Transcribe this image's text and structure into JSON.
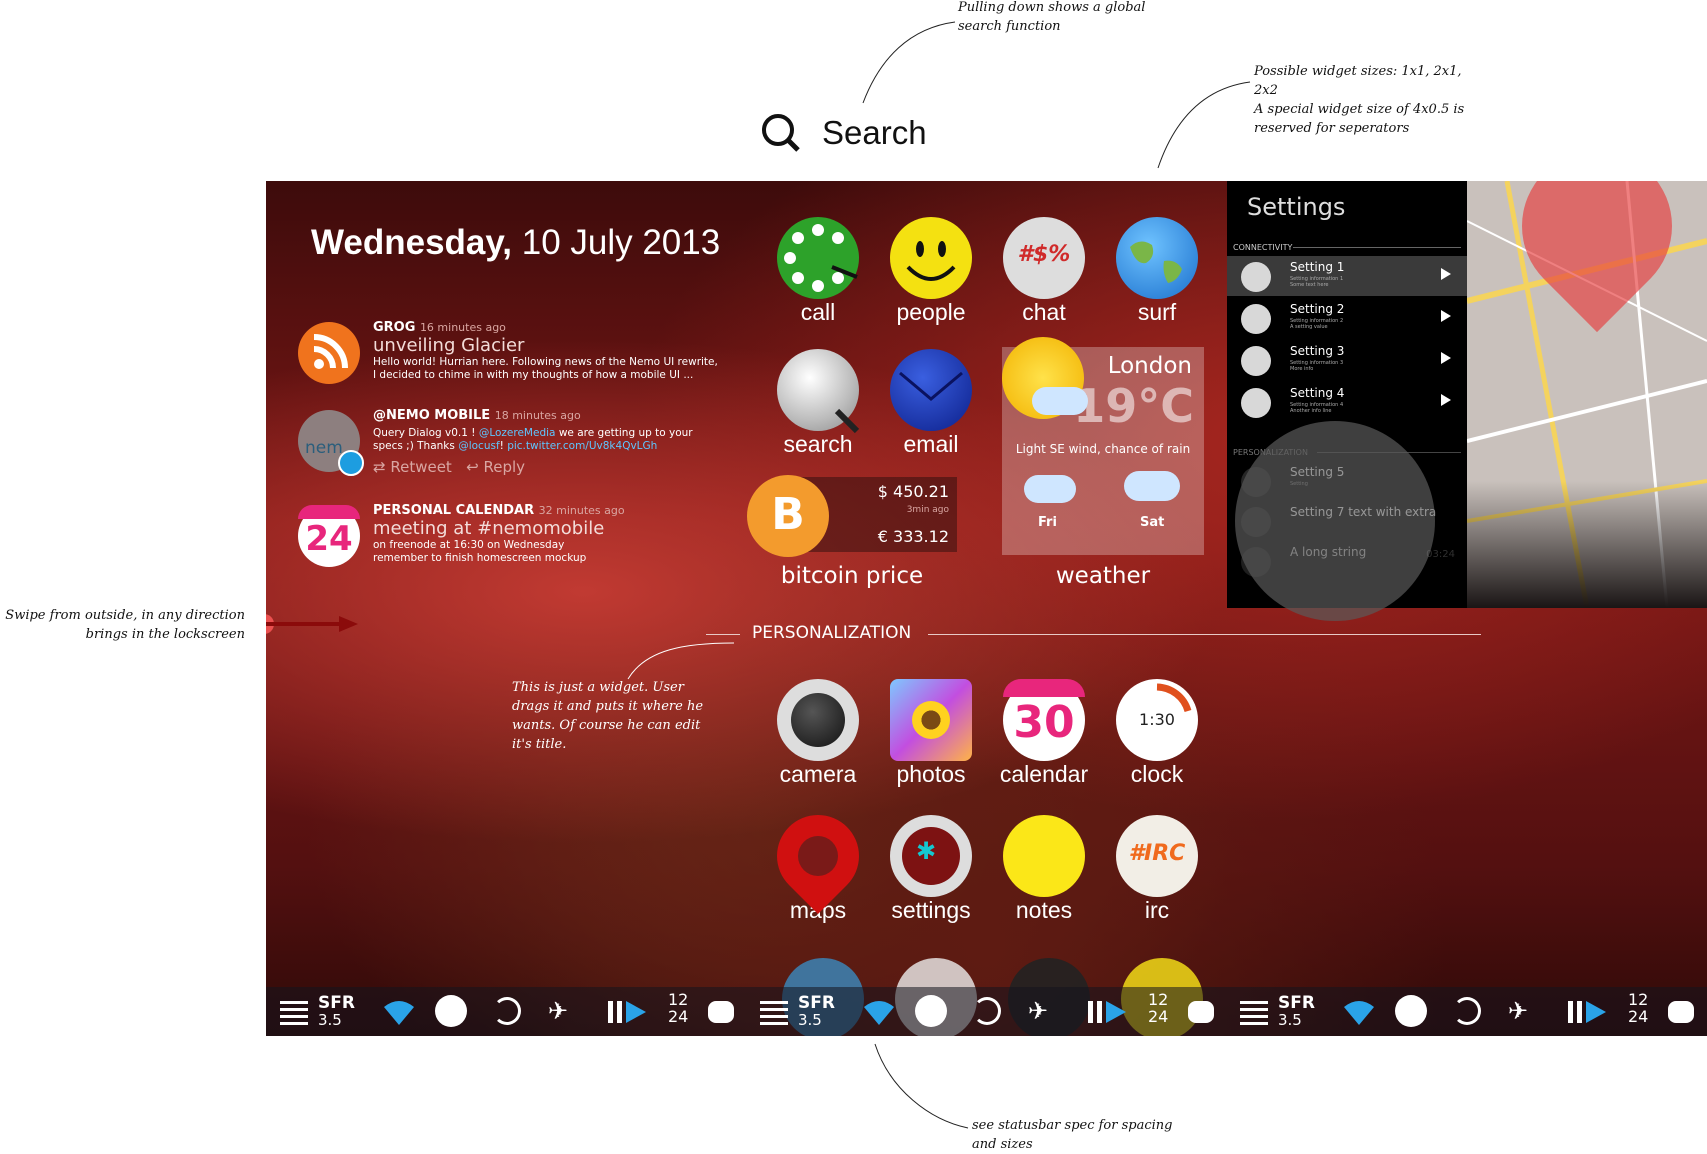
{
  "annotations": {
    "search_note": "Pulling down shows a global\nsearch function",
    "widget_note": "Possible widget sizes: 1x1, 2x1,\n2x2\nA special widget size of 4x0.5 is\nreserved for seperators",
    "swipe_note": "Swipe from outside, in any direction\nbrings in the lockscreen",
    "widget_drag_note": "This is just a widget. User\ndrags it and puts it where he\nwants. Of course he can edit\nit's title.",
    "statusbar_note": "see statusbar spec for spacing\nand sizes"
  },
  "search": {
    "label": "Search"
  },
  "date": {
    "day": "Wednesday,",
    "rest": " 10 July 2013"
  },
  "feed": [
    {
      "source": "GROG",
      "time": "16 minutes ago",
      "title": "unveiling Glacier",
      "text": "Hello world! Hurrian here. Following news of the Nemo UI rewrite, I decided to chime in with my thoughts of how a mobile UI ..."
    },
    {
      "source": "@NEMO MOBILE",
      "time": "18 minutes ago",
      "text_a": "Query Dialog v0.1 ! ",
      "link1": "@LozereMedia",
      "text_b": " we are getting up to your specs ;) Thanks ",
      "link2": "@locusf",
      "text_c": "! ",
      "link3": "pic.twitter.com/Uv8k4QvLGh",
      "retweet": "Retweet",
      "reply": "Reply",
      "avatar_text": "nem"
    },
    {
      "source": "PERSONAL CALENDAR",
      "time": "32 minutes ago",
      "title": "meeting at #nemomobile",
      "text": "on freenode at 16:30 on Wednesday\nremember to finish homescreen mockup",
      "badge": "24"
    }
  ],
  "apps": {
    "call": "call",
    "people": "people",
    "chat": "chat",
    "chat_icon": "#$%",
    "surf": "surf",
    "search": "search",
    "email": "email",
    "bitcoin": "bitcoin price",
    "weather": "weather",
    "camera": "camera",
    "photos": "photos",
    "calendar": "calendar",
    "calendar_day": "30",
    "clock": "clock",
    "clock_time": "1:30",
    "maps": "maps",
    "settings": "settings",
    "notes": "notes",
    "irc": "irc",
    "irc_icon": "#IRC"
  },
  "bitcoin_widget": {
    "usd": "$ 450.21",
    "ago": "3min ago",
    "eur": "€ 333.12",
    "symbol": "B"
  },
  "weather_widget": {
    "city": "London",
    "temp": "19°C",
    "desc": "Light SE wind, chance of rain",
    "day1": "Fri",
    "day2": "Sat"
  },
  "section": {
    "title": "PERSONALIZATION"
  },
  "statusbar": {
    "carrier": "SFR",
    "network": "3.5",
    "time_h": "12",
    "time_m": "24"
  },
  "settings_panel": {
    "title": "Settings",
    "section1": "CONNECTIVITY",
    "section2": "PERSONALIZATION",
    "rows": [
      {
        "label": "Setting 1",
        "info": "Setting information 1",
        "extra": "Some text here"
      },
      {
        "label": "Setting 2",
        "info": "Setting information 2",
        "extra": "A setting value"
      },
      {
        "label": "Setting 3",
        "info": "Setting information 3",
        "extra": "More info"
      },
      {
        "label": "Setting 4",
        "info": "Setting information 4",
        "extra": "Another info line"
      },
      {
        "label": "Setting 5",
        "info": "Setting"
      },
      {
        "label": "Setting 7 text with extra"
      },
      {
        "label": "A long string",
        "extra": "03:24"
      }
    ]
  },
  "colors": {
    "rss": "#f0731d",
    "twitter": "#1d9de0",
    "calendar": "#e8267c",
    "bitcoin": "#f39b2d",
    "accent_blue": "#2aa3e8"
  }
}
